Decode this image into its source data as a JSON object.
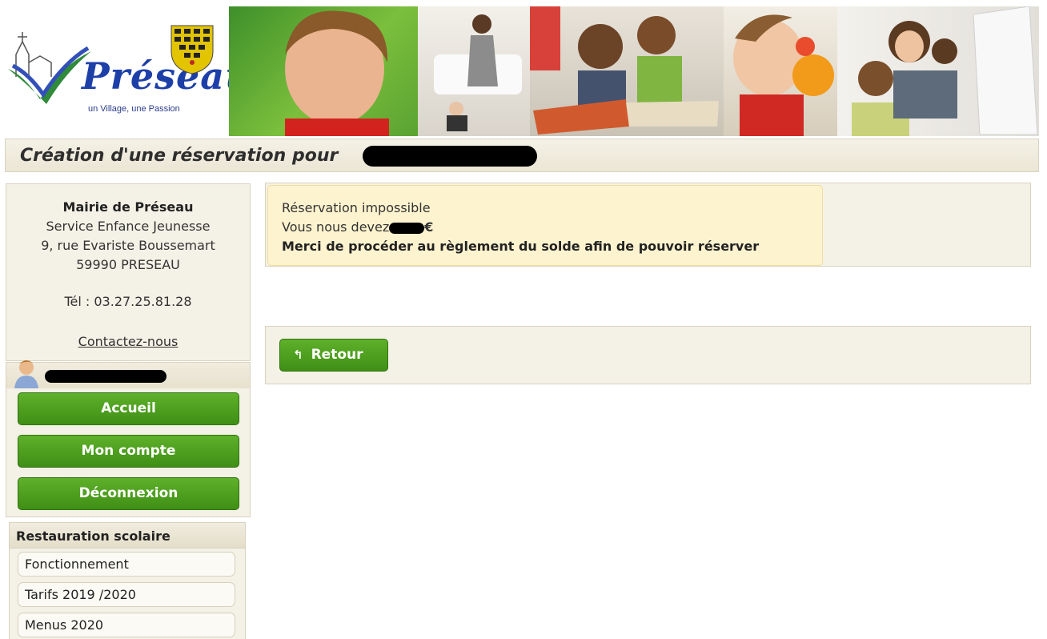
{
  "banner": {
    "logo_name": "Préseau",
    "logo_tagline": "un Village, une Passion"
  },
  "page": {
    "title": "Création d'une réservation pour"
  },
  "contact": {
    "org": "Mairie de Préseau",
    "service": "Service Enfance Jeunesse",
    "address": "9, rue Evariste Boussemart",
    "city": "59990 PRESEAU",
    "phone": "Tél : 03.27.25.81.28",
    "contact_link": "Contactez-nous"
  },
  "user_menu": {
    "buttons": [
      {
        "label": "Accueil"
      },
      {
        "label": "Mon compte"
      },
      {
        "label": "Déconnexion"
      }
    ]
  },
  "restauration": {
    "heading": "Restauration scolaire",
    "items": [
      {
        "label": "Fonctionnement"
      },
      {
        "label": "Tarifs 2019 /2020"
      },
      {
        "label": "Menus 2020"
      }
    ]
  },
  "alert": {
    "line1": "Réservation impossible",
    "line2_prefix": "Vous nous devez",
    "line2_suffix": "€",
    "line3": "Merci de procéder au règlement du solde afin de pouvoir réserver"
  },
  "actions": {
    "back_label": "Retour",
    "back_icon": "reply-arrow-icon"
  },
  "colors": {
    "button_green": "#4a9b1e",
    "panel_beige": "#f4f1e6",
    "alert_yellow": "#fdf3cf",
    "logo_blue": "#1d3fa8"
  }
}
